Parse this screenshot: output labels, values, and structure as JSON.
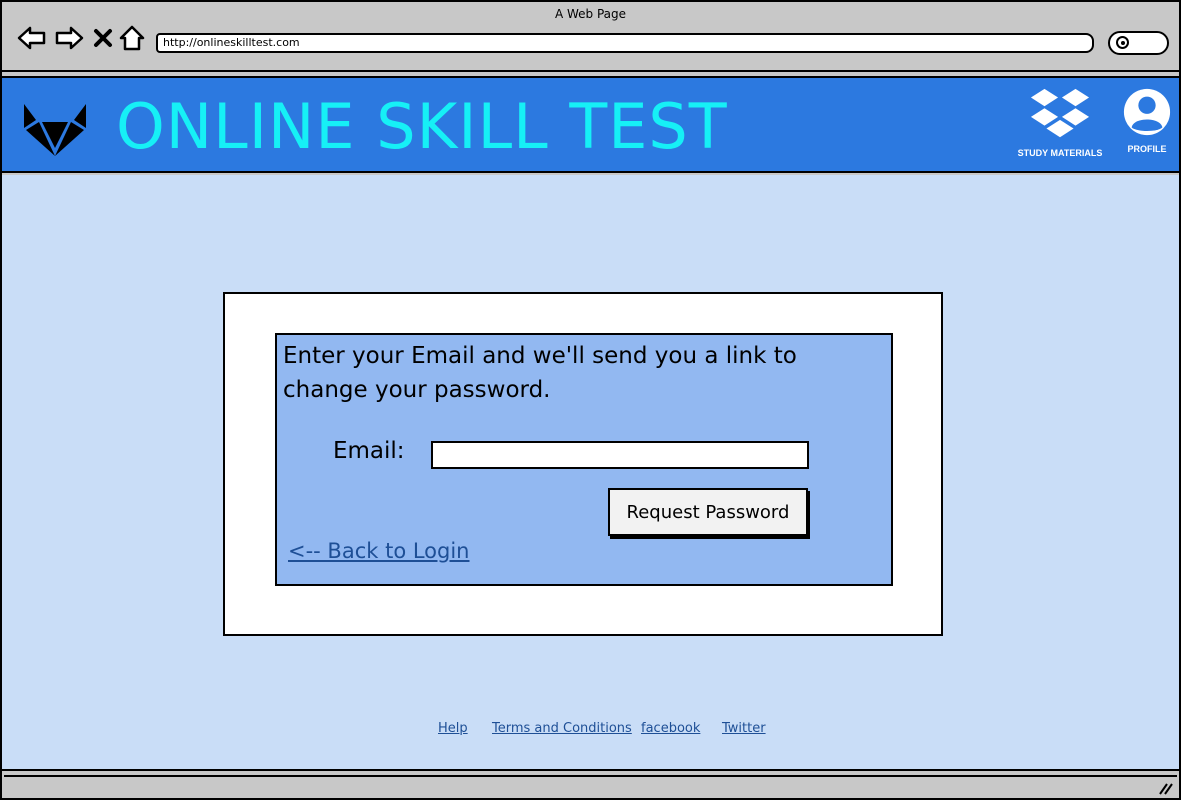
{
  "browser": {
    "window_title": "A Web Page",
    "url": "http://onlineskilltest.com",
    "icons": [
      "back-arrow-icon",
      "forward-arrow-icon",
      "close-x-icon",
      "home-icon",
      "search-icon"
    ]
  },
  "header": {
    "title": "ONLINE SKILL TEST",
    "logo_icon": "fox-logo-icon",
    "actions": [
      {
        "label": "STUDY MATERIALS",
        "icon": "dropbox-icon"
      },
      {
        "label": "PROFILE",
        "icon": "user-icon"
      }
    ]
  },
  "form": {
    "instructions": "Enter your Email and we'll send you a link to change your password.",
    "email_label": "Email:",
    "email_value": "",
    "submit_label": "Request Password",
    "back_link": "<-- Back to Login"
  },
  "footer": {
    "links": [
      "Help",
      "Terms and Conditions",
      "facebook",
      "Twitter"
    ]
  },
  "colors": {
    "header_bg": "#2c79e0",
    "title_color": "#16f0f6",
    "page_bg": "#c9ddf7",
    "form_bg": "#92b8f1",
    "link_color": "#1e4f96"
  }
}
